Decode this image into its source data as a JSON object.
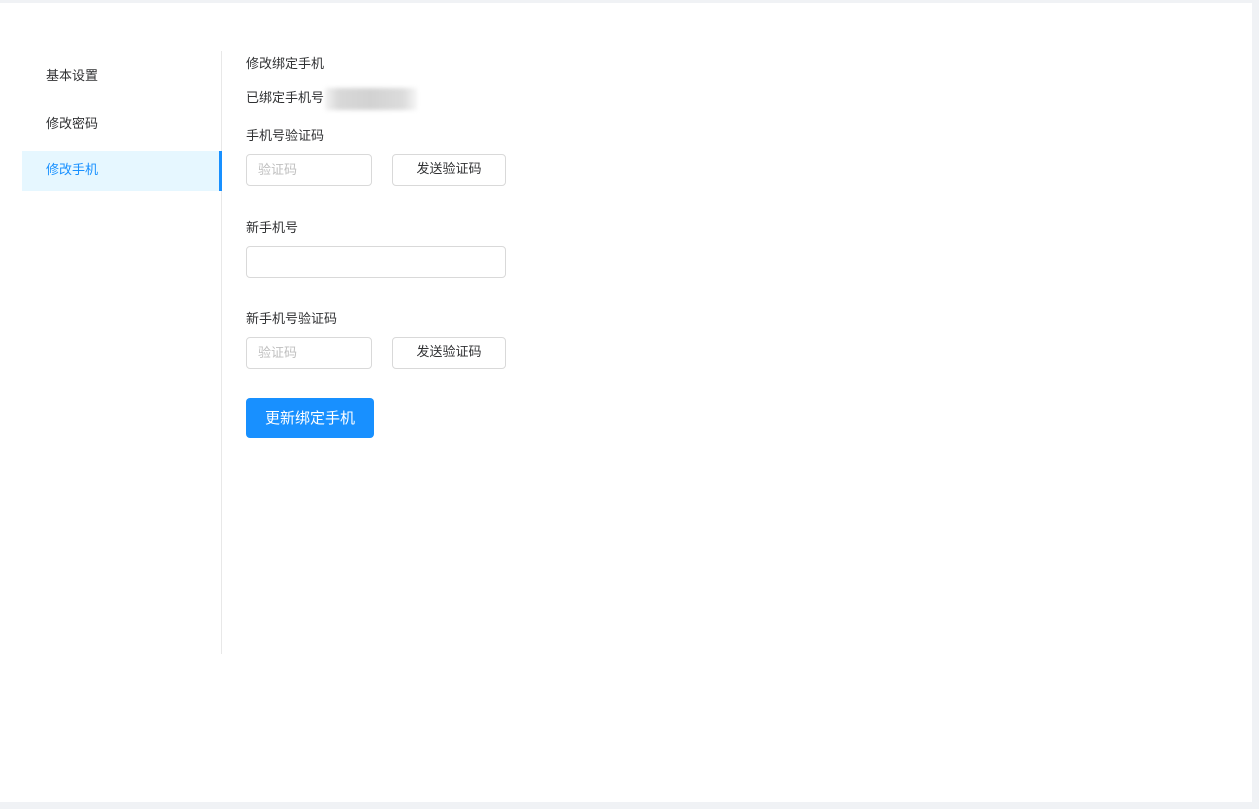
{
  "sidebar": {
    "items": [
      {
        "label": "基本设置",
        "active": false
      },
      {
        "label": "修改密码",
        "active": false
      },
      {
        "label": "修改手机",
        "active": true
      }
    ]
  },
  "form": {
    "title": "修改绑定手机",
    "bound_phone_label": "已绑定手机号",
    "old_code_label": "手机号验证码",
    "old_code_placeholder": "验证码",
    "send_code_label": "发送验证码",
    "new_phone_label": "新手机号",
    "new_phone_value": "",
    "new_code_label": "新手机号验证码",
    "new_code_placeholder": "验证码",
    "send_new_code_label": "发送验证码",
    "submit_label": "更新绑定手机"
  },
  "colors": {
    "accent": "#1890ff",
    "active_bg": "#e6f7ff"
  }
}
